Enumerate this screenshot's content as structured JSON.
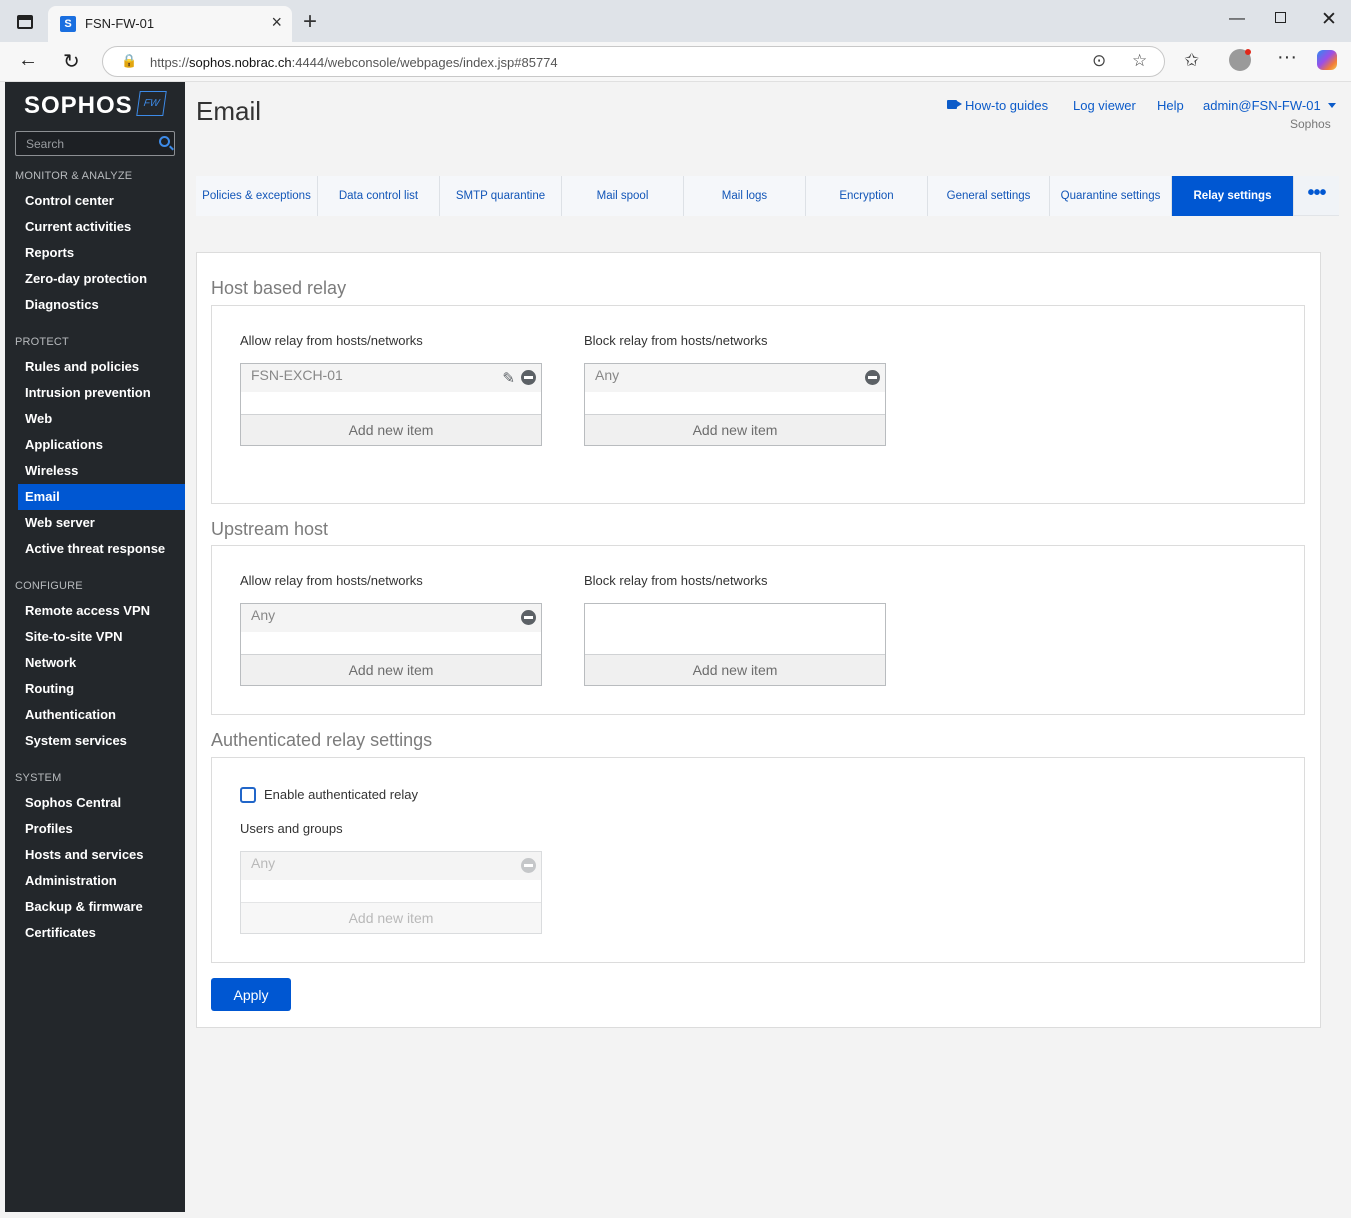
{
  "browser": {
    "tab_title": "FSN-FW-01",
    "favicon_letter": "S",
    "url_prefix": "https://",
    "url_host": "sophos.nobrac.ch",
    "url_path": ":4444/webconsole/webpages/index.jsp#85774"
  },
  "sidebar": {
    "logo": "SOPHOS",
    "logo_badge": "FW",
    "search_placeholder": "Search",
    "sections": [
      {
        "title": "MONITOR & ANALYZE",
        "items": [
          "Control center",
          "Current activities",
          "Reports",
          "Zero-day protection",
          "Diagnostics"
        ]
      },
      {
        "title": "PROTECT",
        "items": [
          "Rules and policies",
          "Intrusion prevention",
          "Web",
          "Applications",
          "Wireless",
          "Email",
          "Web server",
          "Active threat response"
        ]
      },
      {
        "title": "CONFIGURE",
        "items": [
          "Remote access VPN",
          "Site-to-site VPN",
          "Network",
          "Routing",
          "Authentication",
          "System services"
        ]
      },
      {
        "title": "SYSTEM",
        "items": [
          "Sophos Central",
          "Profiles",
          "Hosts and services",
          "Administration",
          "Backup & firmware",
          "Certificates"
        ]
      }
    ],
    "active_item": "Email"
  },
  "header": {
    "title": "Email",
    "links": [
      "How-to guides",
      "Log viewer",
      "Help"
    ],
    "user": "admin@FSN-FW-01",
    "user_sub": "Sophos"
  },
  "tabs": [
    "Policies & exceptions",
    "Data control list",
    "SMTP quarantine",
    "Mail spool",
    "Mail logs",
    "Encryption",
    "General settings",
    "Quarantine settings",
    "Relay settings"
  ],
  "active_tab": "Relay settings",
  "host_relay": {
    "title": "Host based relay",
    "allow_label": "Allow relay from hosts/networks",
    "allow_items": [
      "FSN-EXCH-01"
    ],
    "block_label": "Block relay from hosts/networks",
    "block_items": [
      "Any"
    ],
    "add_label": "Add new item"
  },
  "upstream": {
    "title": "Upstream host",
    "allow_label": "Allow relay from hosts/networks",
    "allow_items": [
      "Any"
    ],
    "block_label": "Block relay from hosts/networks",
    "block_items": [],
    "add_label": "Add new item"
  },
  "auth_relay": {
    "title": "Authenticated relay settings",
    "checkbox_label": "Enable authenticated relay",
    "checked": false,
    "users_label": "Users and groups",
    "users_items": [
      "Any"
    ],
    "add_label": "Add new item"
  },
  "apply_label": "Apply"
}
